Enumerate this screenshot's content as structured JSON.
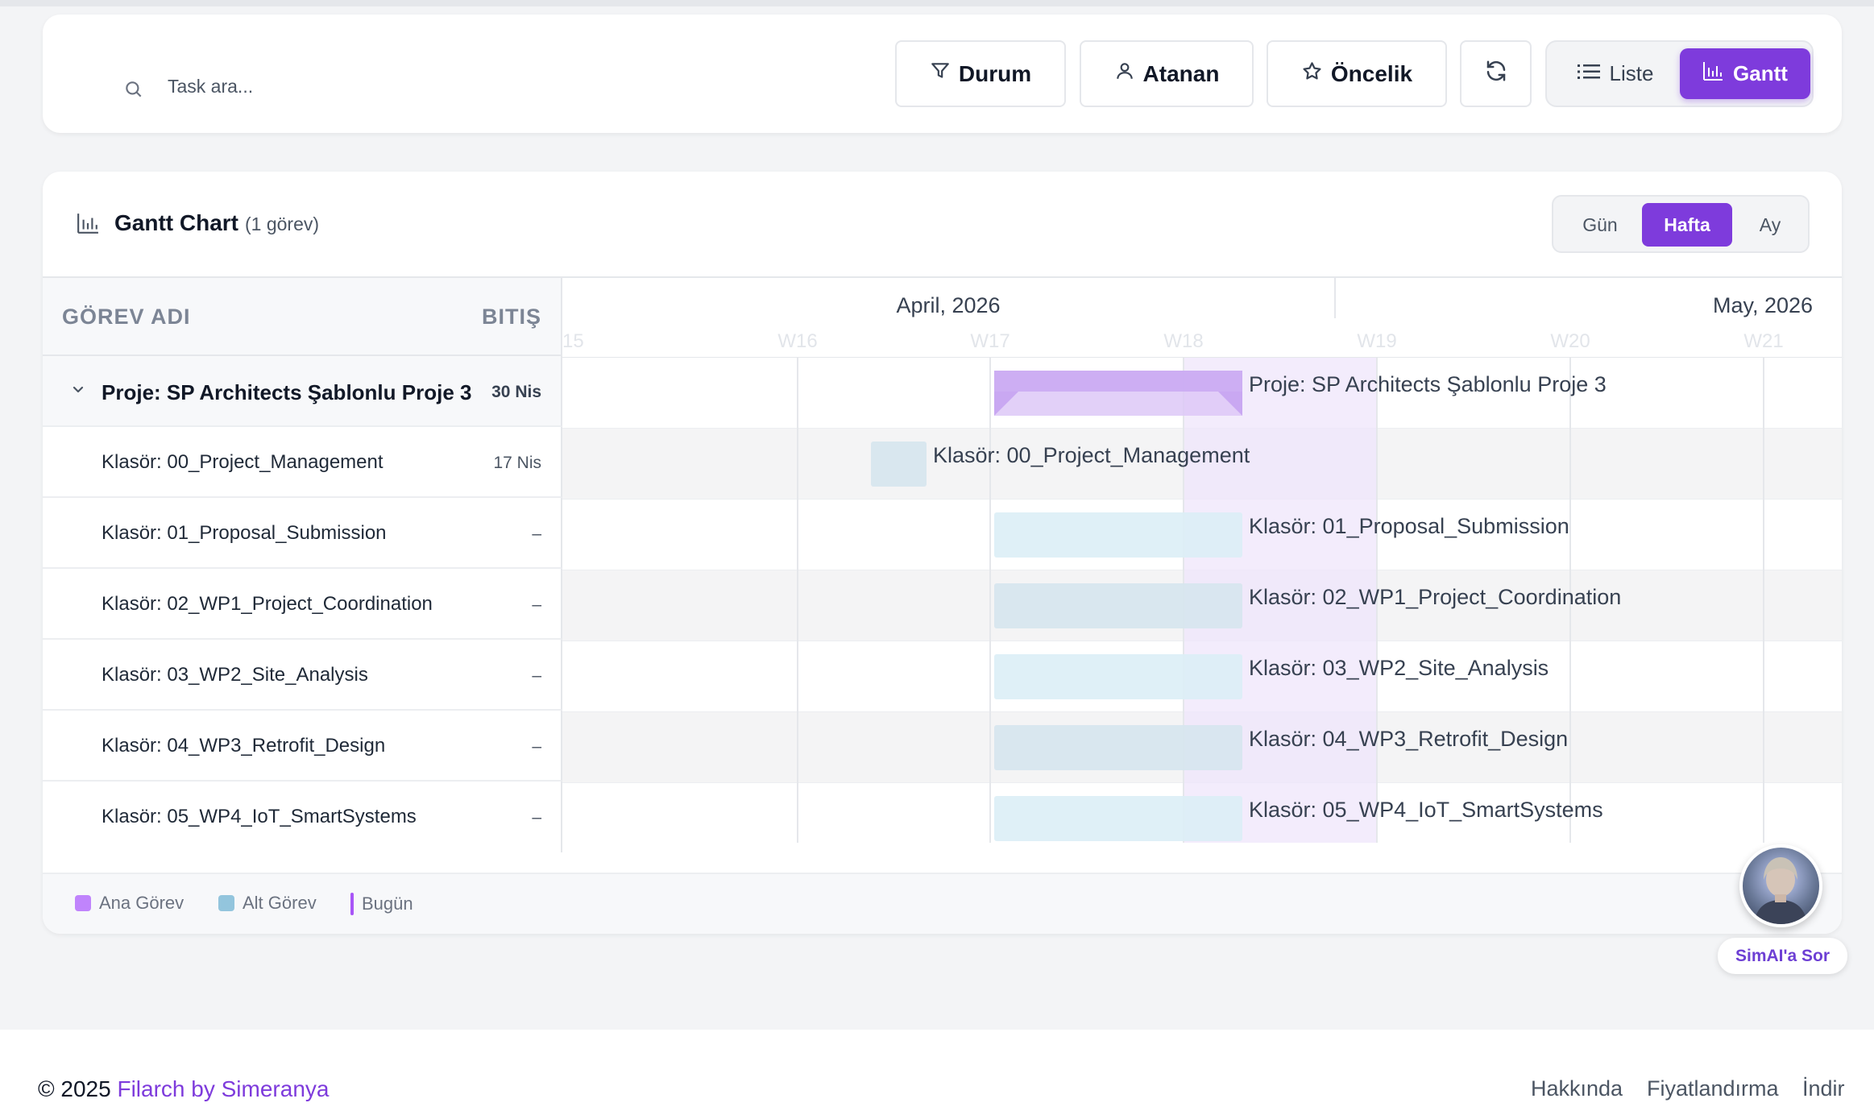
{
  "toolbar": {
    "search_placeholder": "Task ara...",
    "filters": {
      "durum": "Durum",
      "atanan": "Atanan",
      "oncelik": "Öncelik"
    },
    "view": {
      "liste": "Liste",
      "gantt": "Gantt",
      "active": "Gantt"
    }
  },
  "gantt": {
    "title": "Gantt Chart",
    "count": "(1 görev)",
    "scale": {
      "gun": "Gün",
      "hafta": "Hafta",
      "ay": "Ay",
      "active": "Hafta"
    },
    "columns": {
      "name": "GÖREV ADI",
      "end": "BITIŞ"
    },
    "months": [
      "April, 2026",
      "May, 2026"
    ],
    "weeks": [
      "15",
      "W16",
      "W17",
      "W18",
      "W19",
      "W20",
      "W21"
    ],
    "rows": [
      {
        "name": "Proje: SP Architects Şablonlu Proje 3",
        "end": "30 Nis",
        "type": "parent",
        "bar_label": "Proje: SP Architects Şablonlu Proje 3"
      },
      {
        "name": "Klasör: 00_Project_Management",
        "end": "17 Nis",
        "type": "child",
        "bar_label": "Klasör: 00_Project_Management"
      },
      {
        "name": "Klasör: 01_Proposal_Submission",
        "end": "–",
        "type": "child",
        "bar_label": "Klasör: 01_Proposal_Submission"
      },
      {
        "name": "Klasör: 02_WP1_Project_Coordination",
        "end": "–",
        "type": "child",
        "bar_label": "Klasör: 02_WP1_Project_Coordination"
      },
      {
        "name": "Klasör: 03_WP2_Site_Analysis",
        "end": "–",
        "type": "child",
        "bar_label": "Klasör: 03_WP2_Site_Analysis"
      },
      {
        "name": "Klasör: 04_WP3_Retrofit_Design",
        "end": "–",
        "type": "child",
        "bar_label": "Klasör: 04_WP3_Retrofit_Design"
      },
      {
        "name": "Klasör: 05_WP4_IoT_SmartSystems",
        "end": "–",
        "type": "child",
        "bar_label": "Klasör: 05_WP4_IoT_SmartSystems"
      }
    ],
    "legend": {
      "main": "Ana Görev",
      "sub": "Alt Görev",
      "today": "Bugün"
    }
  },
  "assistant": {
    "label": "SimAI'a Sor"
  },
  "footer": {
    "copyright": "© 2025",
    "brand": "Filarch by Simeranya",
    "links": [
      "Hakkında",
      "Fiyatlandırma",
      "İndir"
    ]
  },
  "colors": {
    "accent": "#7e3bdc",
    "parent_bar": "#d9c4f5",
    "child_bar": "#dbeaf2",
    "today_band": "#efe6fb"
  }
}
